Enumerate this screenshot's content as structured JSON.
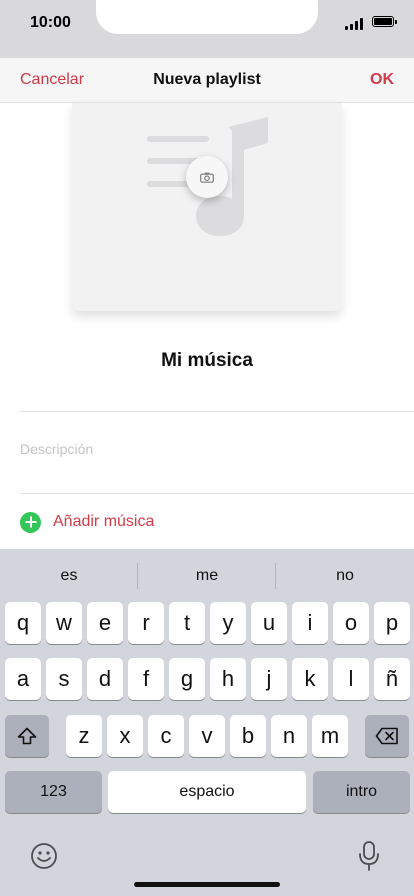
{
  "status_bar": {
    "time": "10:00"
  },
  "nav": {
    "cancel": "Cancelar",
    "title": "Nueva playlist",
    "ok": "OK"
  },
  "playlist": {
    "name": "Mi música",
    "description_placeholder": "Descripción"
  },
  "add_music": {
    "label": "Añadir música"
  },
  "suggestions": [
    "es",
    "me",
    "no"
  ],
  "keyboard": {
    "row1": [
      "q",
      "w",
      "e",
      "r",
      "t",
      "y",
      "u",
      "i",
      "o",
      "p"
    ],
    "row2": [
      "a",
      "s",
      "d",
      "f",
      "g",
      "h",
      "j",
      "k",
      "l",
      "ñ"
    ],
    "row3": [
      "z",
      "x",
      "c",
      "v",
      "b",
      "n",
      "m"
    ],
    "numbers": "123",
    "space": "espacio",
    "return": "intro"
  },
  "icons": {
    "shift": "shift-icon",
    "backspace": "backspace-icon",
    "emoji": "emoji-icon",
    "microphone": "microphone-icon",
    "camera": "camera-icon",
    "music_note": "music-note-icon"
  },
  "colors": {
    "accent": "#d23a48",
    "add_green": "#35c65a"
  }
}
